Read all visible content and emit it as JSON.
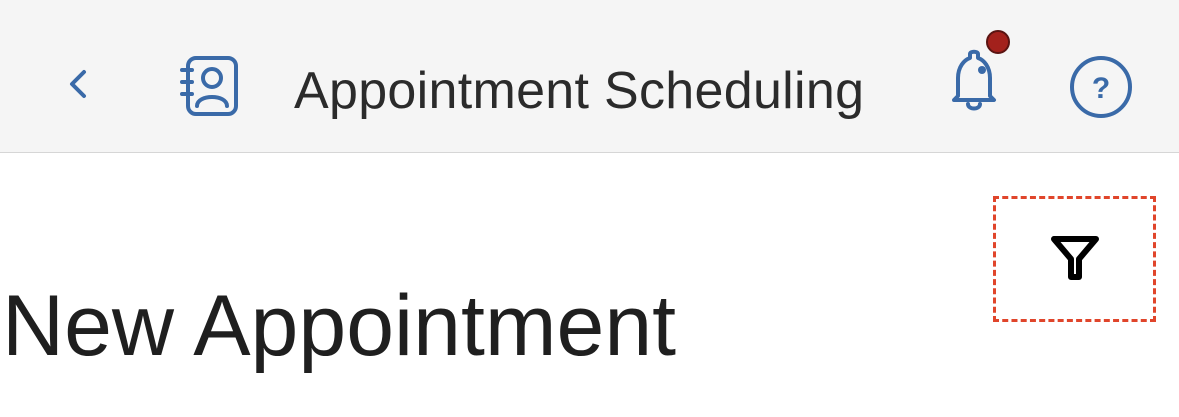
{
  "header": {
    "title": "Appointment Scheduling",
    "back_icon": "chevron-left-icon",
    "app_icon": "contact-book-icon",
    "notifications_icon": "bell-icon",
    "help_icon": "help-circle-icon",
    "help_glyph": "?",
    "accent_color": "#3a6aa8",
    "badge_color": "#a3211c"
  },
  "main": {
    "page_title": "New Appointment",
    "filter_icon": "filter-icon",
    "filter_highlight_color": "#e0452b"
  }
}
